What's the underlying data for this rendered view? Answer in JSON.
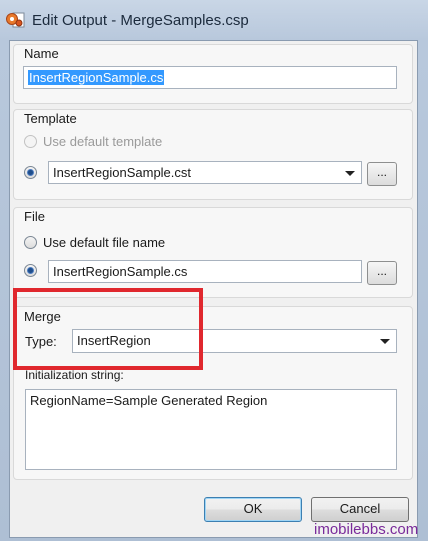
{
  "window": {
    "title": "Edit Output - MergeSamples.csp",
    "icon": "gear-document-icon"
  },
  "name_group": {
    "label": "Name",
    "value": "InsertRegionSample.cs"
  },
  "template_group": {
    "label": "Template",
    "default_radio_label": "Use default template",
    "file_value": "InsertRegionSample.cst",
    "browse_label": "..."
  },
  "file_group": {
    "label": "File",
    "default_radio_label": "Use default file name",
    "file_value": "InsertRegionSample.cs",
    "browse_label": "..."
  },
  "merge_group": {
    "label": "Merge",
    "type_label": "Type:",
    "type_value": "InsertRegion",
    "init_label": "Initialization string:",
    "init_value": "RegionName=Sample Generated Region"
  },
  "buttons": {
    "ok": "OK",
    "cancel": "Cancel"
  },
  "watermark": "imobilebbs.com",
  "colors": {
    "highlight": "#e0282e",
    "selection": "#3399ff",
    "watermark": "#7a2a9a"
  }
}
